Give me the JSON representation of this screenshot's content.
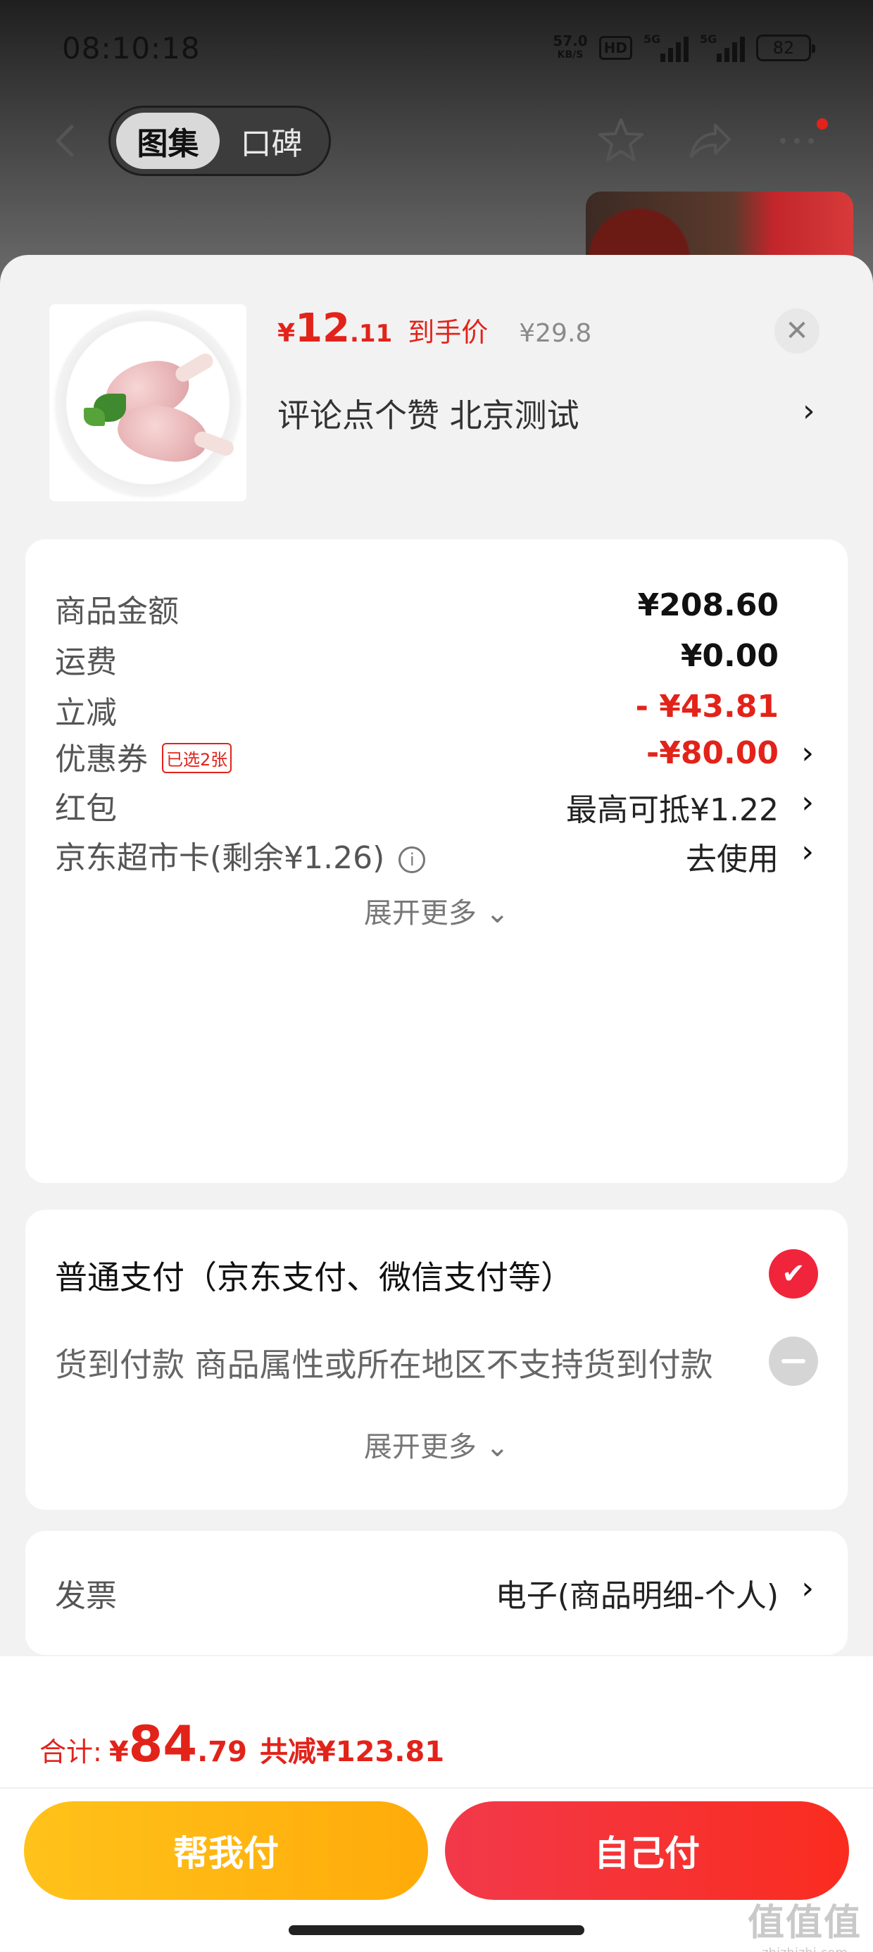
{
  "status_bar": {
    "time": "08:10:18",
    "net_speed_value": "57.0",
    "net_speed_unit": "KB/S",
    "hd_label": "HD",
    "signal1_label": "5G",
    "signal2_label": "5G",
    "battery": "82"
  },
  "nav": {
    "tabs": [
      {
        "label": "图集",
        "active": true
      },
      {
        "label": "口碑",
        "active": false
      }
    ],
    "icons": [
      "back-icon",
      "star-icon",
      "share-icon",
      "more-icon"
    ]
  },
  "product": {
    "price_symbol": "¥",
    "price_integer": "12",
    "price_decimal": ".11",
    "price_tag": "到手价",
    "original_price": "¥29.8",
    "subtitle": "评论点个赞  北京测试",
    "chevron": "›",
    "close_glyph": "✕"
  },
  "price_details": {
    "rows": [
      {
        "label": "商品金额",
        "value": "¥208.60"
      },
      {
        "label": "运费",
        "value": "¥0.00"
      },
      {
        "label": "立减",
        "value": "- ¥43.81"
      },
      {
        "label": "优惠券",
        "badge": "已选2张",
        "value": "-¥80.00",
        "chevron": "›"
      },
      {
        "label": "红包",
        "value": "最高可抵¥1.22",
        "chevron": "›"
      },
      {
        "label": "京东超市卡(剩余¥1.26)",
        "info": "i",
        "value": "去使用",
        "chevron": "›"
      }
    ],
    "expand_label": "展开更多 ⌄"
  },
  "payment": {
    "options": [
      {
        "label": "普通支付（京东支付、微信支付等）",
        "selected": true
      },
      {
        "label": "货到付款 商品属性或所在地区不支持货到付款",
        "selected": false
      }
    ],
    "expand_label": "展开更多 ⌄",
    "check_glyph": "✔"
  },
  "invoice": {
    "label": "发票",
    "value": "电子(商品明细-个人)",
    "chevron": "›"
  },
  "summary": {
    "label": "合计:",
    "symbol": "¥",
    "integer": "84",
    "decimal": ".79",
    "saved": "共减¥123.81"
  },
  "buttons": {
    "friend_pay": "帮我付",
    "self_pay": "自己付"
  },
  "watermark": {
    "big": "值值值",
    "small": "zhizhizhi.com"
  },
  "colors": {
    "accent_red": "#e2231a",
    "check_red": "#f0243b",
    "button_yellow": "#ffb810",
    "button_red": "#f5322f"
  }
}
